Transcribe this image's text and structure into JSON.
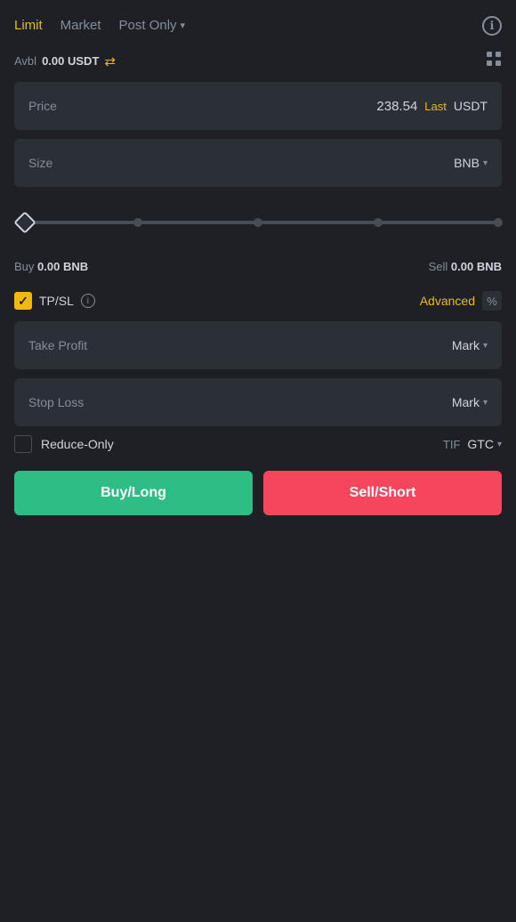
{
  "tabs": {
    "limit_label": "Limit",
    "market_label": "Market",
    "postonly_label": "Post Only",
    "active_tab": "limit"
  },
  "header": {
    "info_icon": "ℹ"
  },
  "balance": {
    "avbl_label": "Avbl",
    "avbl_value": "0.00",
    "avbl_currency": "USDT",
    "transfer_icon": "⇄"
  },
  "price_field": {
    "label": "Price",
    "value": "238.54",
    "last_label": "Last",
    "currency": "USDT"
  },
  "size_field": {
    "label": "Size",
    "currency": "BNB"
  },
  "slider": {
    "percentage": 0,
    "dots": [
      25,
      50,
      75,
      100
    ]
  },
  "buy_sell": {
    "buy_prefix": "Buy",
    "buy_value": "0.00",
    "buy_currency": "BNB",
    "sell_prefix": "Sell",
    "sell_value": "0.00",
    "sell_currency": "BNB"
  },
  "tpsl": {
    "checked": true,
    "label": "TP/SL",
    "advanced_label": "Advanced",
    "percent_symbol": "%"
  },
  "take_profit": {
    "label": "Take Profit",
    "trigger_label": "Mark"
  },
  "stop_loss": {
    "label": "Stop Loss",
    "trigger_label": "Mark"
  },
  "reduce_only": {
    "checked": false,
    "label": "Reduce-Only",
    "tif_label": "TIF",
    "gtc_label": "GTC"
  },
  "buttons": {
    "buy_label": "Buy/Long",
    "sell_label": "Sell/Short"
  }
}
